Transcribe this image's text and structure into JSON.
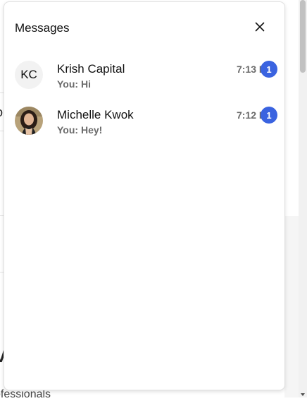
{
  "colors": {
    "badge": "#3a63e0",
    "panel_border": "#e0e0e0",
    "muted_text": "#6b6b6b"
  },
  "background": {
    "frag_t": "t",
    "frag_ol": "ol",
    "frag_v": "V",
    "frag_professionals": "ofessionals"
  },
  "messages_panel": {
    "title": "Messages",
    "close_icon": "close-icon",
    "conversations": [
      {
        "name": "Krish Capital",
        "avatar_initials": "KC",
        "avatar_type": "initials",
        "preview": "You: Hi",
        "time": "7:13 PM",
        "unread": "1"
      },
      {
        "name": "Michelle Kwok",
        "avatar_initials": "",
        "avatar_type": "photo",
        "preview": "You: Hey!",
        "time": "7:12 PM",
        "unread": "1"
      }
    ]
  }
}
